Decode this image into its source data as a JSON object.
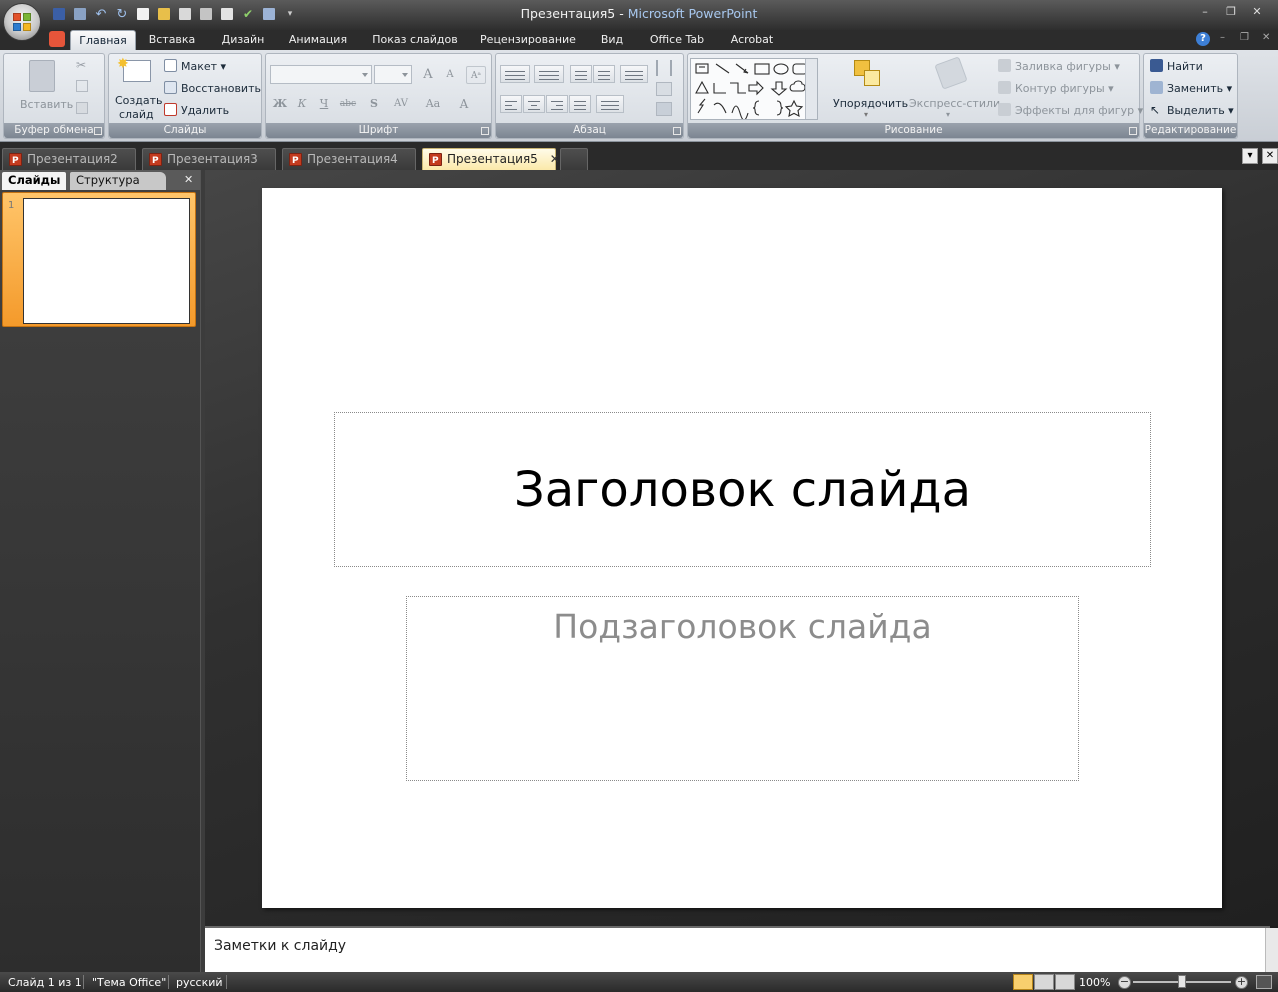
{
  "window": {
    "doc_title": "Презентация5",
    "separator": " - ",
    "app_name": "Microsoft PowerPoint",
    "controls": {
      "minimize": "–",
      "restore": "❐",
      "close": "✕"
    },
    "ribbon_controls": {
      "help": "?",
      "minimize": "–",
      "restore": "❐",
      "close": "✕"
    }
  },
  "ribbon_tabs": [
    {
      "label": "Главная",
      "active": true
    },
    {
      "label": "Вставка"
    },
    {
      "label": "Дизайн"
    },
    {
      "label": "Анимация"
    },
    {
      "label": "Показ слайдов"
    },
    {
      "label": "Рецензирование"
    },
    {
      "label": "Вид"
    },
    {
      "label": "Office Tab"
    },
    {
      "label": "Acrobat"
    }
  ],
  "groups": {
    "clipboard": {
      "label": "Буфер обмена",
      "paste": "Вставить"
    },
    "slides": {
      "label": "Слайды",
      "new_slide_1": "Создать",
      "new_slide_2": "слайд",
      "layout": "Макет",
      "reset": "Восстановить",
      "delete": "Удалить"
    },
    "font": {
      "label": "Шрифт",
      "bold": "Ж",
      "italic": "К",
      "underline": "Ч",
      "strike": "abc",
      "shadow": "S",
      "spacing": "AV",
      "case": "Aa",
      "grow": "A",
      "shrink": "A",
      "color": "A"
    },
    "paragraph": {
      "label": "Абзац"
    },
    "drawing": {
      "label": "Рисование",
      "arrange": "Упорядочить",
      "quick_styles": "Экспресс-стили",
      "shape_fill": "Заливка фигуры",
      "shape_outline": "Контур фигуры",
      "shape_effects": "Эффекты для фигур"
    },
    "editing": {
      "label": "Редактирование",
      "find": "Найти",
      "replace": "Заменить",
      "select": "Выделить"
    }
  },
  "doc_tabs": [
    {
      "label": "Презентация2"
    },
    {
      "label": "Презентация3"
    },
    {
      "label": "Презентация4"
    },
    {
      "label": "Презентация5",
      "active": true,
      "close": "✕"
    }
  ],
  "doc_tab_controls": {
    "menu": "▾",
    "close": "✕"
  },
  "left_pane": {
    "tab_slides": "Слайды",
    "tab_outline": "Структура",
    "close": "✕",
    "slide_number": "1"
  },
  "slide": {
    "title": "Заголовок слайда",
    "subtitle": "Подзаголовок слайда"
  },
  "notes": {
    "placeholder": "Заметки к слайду"
  },
  "status": {
    "slide_info": "Слайд 1 из 1",
    "theme": "\"Тема Office\"",
    "language": "русский",
    "zoom": "100%",
    "zoom_out": "−",
    "zoom_in": "+"
  },
  "colors": {
    "accent_tab": "#f8cf6e",
    "office_button": "#e8e8e8",
    "title_app": "#a8c8ef"
  }
}
